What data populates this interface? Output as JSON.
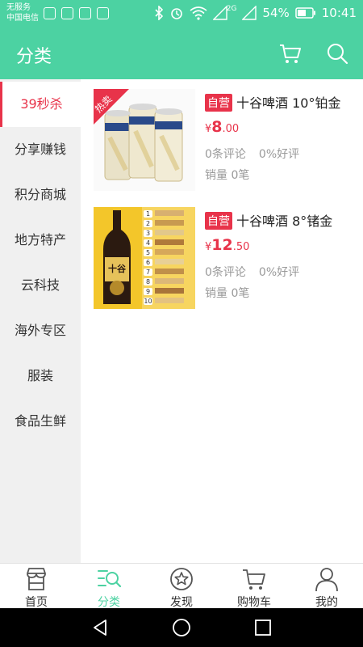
{
  "status_bar": {
    "carrier_line1": "无服务",
    "carrier_line2": "中国电信",
    "network": "2G",
    "battery": "54%",
    "time": "10:41"
  },
  "app_bar": {
    "title": "分类",
    "cart_icon": "cart-icon",
    "search_icon": "search-icon"
  },
  "sidebar": {
    "items": [
      {
        "label": "39秒杀",
        "active": true
      },
      {
        "label": "分享赚钱"
      },
      {
        "label": "积分商城"
      },
      {
        "label": "地方特产"
      },
      {
        "label": "云科技"
      },
      {
        "label": "海外专区"
      },
      {
        "label": "服装"
      },
      {
        "label": "食品生鲜"
      }
    ]
  },
  "products": [
    {
      "hot_tag": "热卖",
      "badge": "自营",
      "title": "十谷啤酒 10°铂金",
      "currency": "¥",
      "price_int": "8",
      "price_dec": ".00",
      "reviews": "0条评论",
      "good_rate": "0%好评",
      "sales": "销量 0笔"
    },
    {
      "badge": "自营",
      "title": "十谷啤酒 8°锗金",
      "currency": "¥",
      "price_int": "12",
      "price_dec": ".50",
      "reviews": "0条评论",
      "good_rate": "0%好评",
      "sales": "销量 0笔",
      "bottle_label": "十谷",
      "ingredient_numbers": [
        "1",
        "2",
        "3",
        "4",
        "5",
        "6",
        "7",
        "8",
        "9",
        "10"
      ]
    }
  ],
  "bottom_nav": {
    "items": [
      {
        "label": "首页",
        "icon": "home-store-icon"
      },
      {
        "label": "分类",
        "icon": "category-icon",
        "active": true
      },
      {
        "label": "发现",
        "icon": "discover-icon"
      },
      {
        "label": "购物车",
        "icon": "cart-icon"
      },
      {
        "label": "我的",
        "icon": "profile-icon"
      }
    ]
  },
  "colors": {
    "accent": "#4cd2a2",
    "price_red": "#e8334a",
    "sidebar_bg": "#f0f0f0"
  }
}
